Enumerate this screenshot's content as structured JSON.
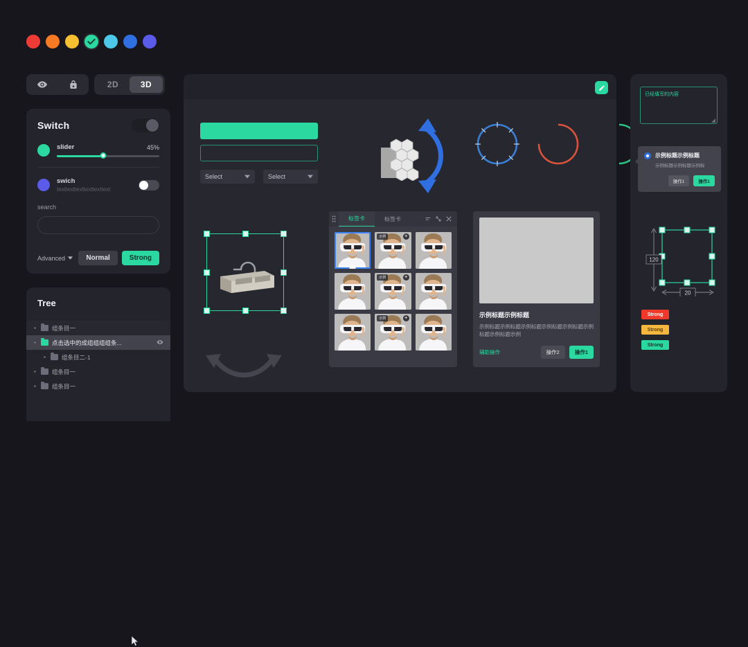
{
  "swatches": [
    {
      "name": "red",
      "color": "#ef3b36",
      "selected": false
    },
    {
      "name": "orange",
      "color": "#f57a23",
      "selected": false
    },
    {
      "name": "yellow",
      "color": "#f7c033",
      "selected": false
    },
    {
      "name": "green",
      "color": "#2bd9a0",
      "selected": true
    },
    {
      "name": "cyan",
      "color": "#4ec8e8",
      "selected": false
    },
    {
      "name": "blue",
      "color": "#2f6fe0",
      "selected": false
    },
    {
      "name": "violet",
      "color": "#5b5bea",
      "selected": false
    }
  ],
  "icon_toolbar": {
    "eye_icon": "eye-icon",
    "lock_icon": "lock-icon"
  },
  "view_segment": {
    "options": [
      "2D",
      "3D"
    ],
    "selected": "3D"
  },
  "switch_panel": {
    "title": "Switch",
    "master_toggle_on": false,
    "slider": {
      "label": "slider",
      "value_label": "45%",
      "percent": 45
    },
    "swich": {
      "label": "swich",
      "sub": "texttexttexttexttexttext",
      "toggle_on": true
    },
    "search": {
      "label": "search",
      "value": "",
      "placeholder": ""
    },
    "advanced_label": "Advanced",
    "buttons": {
      "normal": "Normal",
      "strong": "Strong"
    }
  },
  "tree_panel": {
    "title": "Tree",
    "items": [
      {
        "label": "组条目一",
        "depth": 0,
        "state": "alt",
        "folder": "gray",
        "has_eye": false
      },
      {
        "label": "点击选中的成组组组组条...",
        "depth": 0,
        "state": "active",
        "folder": "green",
        "has_eye": true
      },
      {
        "label": "组条目二-1",
        "depth": 1,
        "state": "normal",
        "folder": "gray",
        "has_eye": false
      },
      {
        "label": "组条目一",
        "depth": 0,
        "state": "normal",
        "folder": "gray",
        "has_eye": false
      },
      {
        "label": "组条目一",
        "depth": 0,
        "state": "normal",
        "folder": "gray",
        "has_eye": false
      }
    ]
  },
  "canvas": {
    "edit_icon": "pencil-icon",
    "selects": [
      {
        "value": "Select"
      },
      {
        "value": "Select"
      }
    ],
    "gauges": [
      {
        "name": "blue-ring",
        "color": "#3b7fd4",
        "percent": 100,
        "ticks": true
      },
      {
        "name": "orange-ring",
        "color": "#d9533c",
        "percent": 75,
        "ticks": false
      },
      {
        "name": "green-ring",
        "color": "#2bbf84",
        "percent": 50,
        "ticks": false
      }
    ],
    "sink_model_name": "kitchen-sink-model"
  },
  "tab_card": {
    "tabs": [
      {
        "label": "标签卡",
        "active": true
      },
      {
        "label": "标签卡",
        "active": false
      }
    ],
    "tools": [
      "collapse-icon",
      "expand-icon",
      "close-icon"
    ],
    "thumbnails": [
      {
        "selected": true,
        "badge": "",
        "has_plus": false,
        "has_dot": true
      },
      {
        "selected": false,
        "badge": "示例",
        "has_plus": true,
        "has_dot": false
      },
      {
        "selected": false,
        "badge": "",
        "has_plus": false,
        "has_dot": false
      },
      {
        "selected": false,
        "badge": "",
        "has_plus": false,
        "has_dot": false
      },
      {
        "selected": false,
        "badge": "示例",
        "has_plus": true,
        "has_dot": false
      },
      {
        "selected": false,
        "badge": "",
        "has_plus": false,
        "has_dot": false
      },
      {
        "selected": false,
        "badge": "",
        "has_plus": false,
        "has_dot": false
      },
      {
        "selected": false,
        "badge": "示例",
        "has_plus": true,
        "has_dot": false
      },
      {
        "selected": false,
        "badge": "",
        "has_plus": false,
        "has_dot": false
      }
    ]
  },
  "info_card": {
    "title": "示例标题示例标题",
    "body": "示例标题示例标题示例标题示例标题示例标题示例标题示例标题示例",
    "link": "辅助操作",
    "secondary_button": "操作2",
    "primary_button": "操作1"
  },
  "right_sidebar": {
    "textarea": {
      "value": "已经填写的内容",
      "placeholder": ""
    },
    "popover": {
      "title": "示例标题示例标题",
      "body": "示例标题示例标题示例标",
      "secondary_button": "操作1",
      "primary_button": "操作1"
    },
    "dimension": {
      "height_label": "120",
      "width_label": "20"
    },
    "tags": [
      {
        "label": "Strong",
        "bg": "#f0392b",
        "fg": "#ffffff"
      },
      {
        "label": "Strong",
        "bg": "#f5b73d",
        "fg": "#5a3c05"
      },
      {
        "label": "Strong",
        "bg": "#2bd9a0",
        "fg": "#10302a"
      }
    ]
  }
}
